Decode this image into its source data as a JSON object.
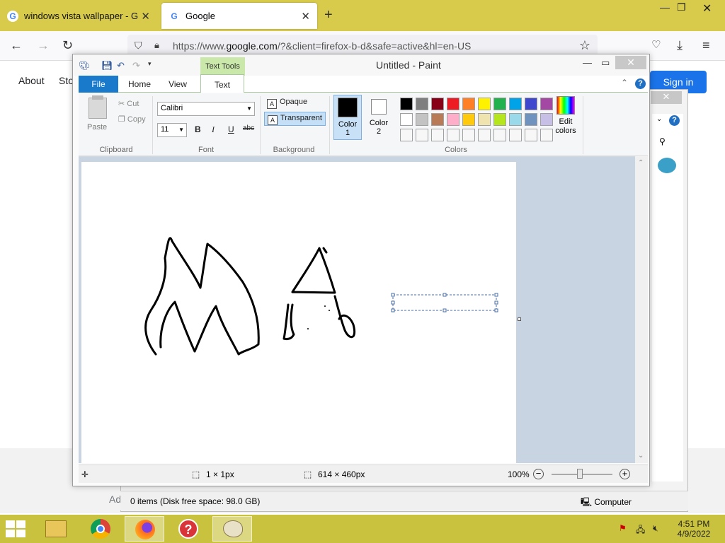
{
  "browser": {
    "tabs": [
      {
        "title": "windows vista wallpaper - Google"
      },
      {
        "title": "Google"
      }
    ],
    "url_prefix": "https://www.",
    "url_domain": "google.com",
    "url_rest": "/?&client=firefox-b-d&safe=active&hl=en-US"
  },
  "google": {
    "about": "About",
    "store": "Sto",
    "sign_in": "Sign in",
    "footer_partial": "Adv"
  },
  "explorer": {
    "status_items": "0 items (Disk free space: 98.0 GB)",
    "status_location": "Computer"
  },
  "paint": {
    "title": "Untitled - Paint",
    "context_tab": "Text Tools",
    "tabs": {
      "file": "File",
      "home": "Home",
      "view": "View",
      "text": "Text"
    },
    "clipboard": {
      "paste": "Paste",
      "cut": "Cut",
      "copy": "Copy",
      "label": "Clipboard"
    },
    "font": {
      "family": "Calibri",
      "size": "11",
      "label": "Font",
      "bold": "B",
      "italic": "I",
      "underline": "U",
      "strike": "abc"
    },
    "background": {
      "opaque": "Opaque",
      "transparent": "Transparent",
      "label": "Background",
      "selected": "Transparent"
    },
    "colors": {
      "color1_line1": "Color",
      "color1_line2": "1",
      "color2_line1": "Color",
      "color2_line2": "2",
      "edit_line1": "Edit",
      "edit_line2": "colors",
      "label": "Colors",
      "color1": "#000000",
      "color2": "#ffffff",
      "palette_row1": [
        "#000000",
        "#7f7f7f",
        "#880015",
        "#ed1c24",
        "#ff7f27",
        "#fff200",
        "#22b14c",
        "#00a2e8",
        "#3f48cc",
        "#a349a4"
      ],
      "palette_row2": [
        "#ffffff",
        "#c3c3c3",
        "#b97a57",
        "#ffaec9",
        "#ffc90e",
        "#efe4b0",
        "#b5e61d",
        "#99d9ea",
        "#7092be",
        "#c8bfe7"
      ],
      "palette_row3": [
        "#f7f7f7",
        "#f7f7f7",
        "#f7f7f7",
        "#f7f7f7",
        "#f7f7f7",
        "#f7f7f7",
        "#f7f7f7",
        "#f7f7f7",
        "#f7f7f7",
        "#f7f7f7"
      ]
    },
    "status": {
      "selection_size": "1 × 1px",
      "image_size": "614 × 460px",
      "zoom": "100%"
    }
  },
  "taskbar": {
    "time": "4:51 PM",
    "date": "4/9/2022"
  }
}
